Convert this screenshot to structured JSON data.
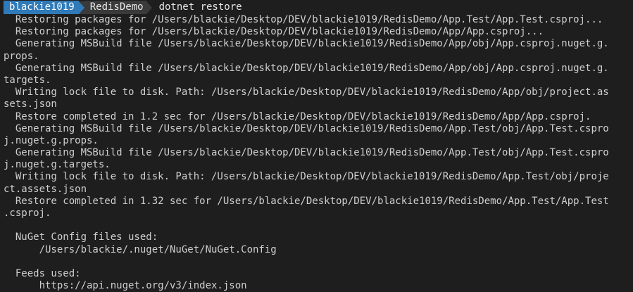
{
  "prompt": {
    "user": "blackie1019",
    "directory": "RedisDemo",
    "command": "dotnet restore"
  },
  "output_lines": [
    "  Restoring packages for /Users/blackie/Desktop/DEV/blackie1019/RedisDemo/App.Test/App.Test.csproj...",
    "  Restoring packages for /Users/blackie/Desktop/DEV/blackie1019/RedisDemo/App/App.csproj...",
    "  Generating MSBuild file /Users/blackie/Desktop/DEV/blackie1019/RedisDemo/App/obj/App.csproj.nuget.g.",
    "props.",
    "  Generating MSBuild file /Users/blackie/Desktop/DEV/blackie1019/RedisDemo/App/obj/App.csproj.nuget.g.",
    "targets.",
    "  Writing lock file to disk. Path: /Users/blackie/Desktop/DEV/blackie1019/RedisDemo/App/obj/project.as",
    "sets.json",
    "  Restore completed in 1.2 sec for /Users/blackie/Desktop/DEV/blackie1019/RedisDemo/App/App.csproj.",
    "  Generating MSBuild file /Users/blackie/Desktop/DEV/blackie1019/RedisDemo/App.Test/obj/App.Test.cspro",
    "j.nuget.g.props.",
    "  Generating MSBuild file /Users/blackie/Desktop/DEV/blackie1019/RedisDemo/App.Test/obj/App.Test.cspro",
    "j.nuget.g.targets.",
    "  Writing lock file to disk. Path: /Users/blackie/Desktop/DEV/blackie1019/RedisDemo/App.Test/obj/proje",
    "ct.assets.json",
    "  Restore completed in 1.32 sec for /Users/blackie/Desktop/DEV/blackie1019/RedisDemo/App.Test/App.Test",
    ".csproj.",
    "",
    "  NuGet Config files used:",
    "      /Users/blackie/.nuget/NuGet/NuGet.Config",
    "",
    "  Feeds used:",
    "      https://api.nuget.org/v3/index.json"
  ]
}
